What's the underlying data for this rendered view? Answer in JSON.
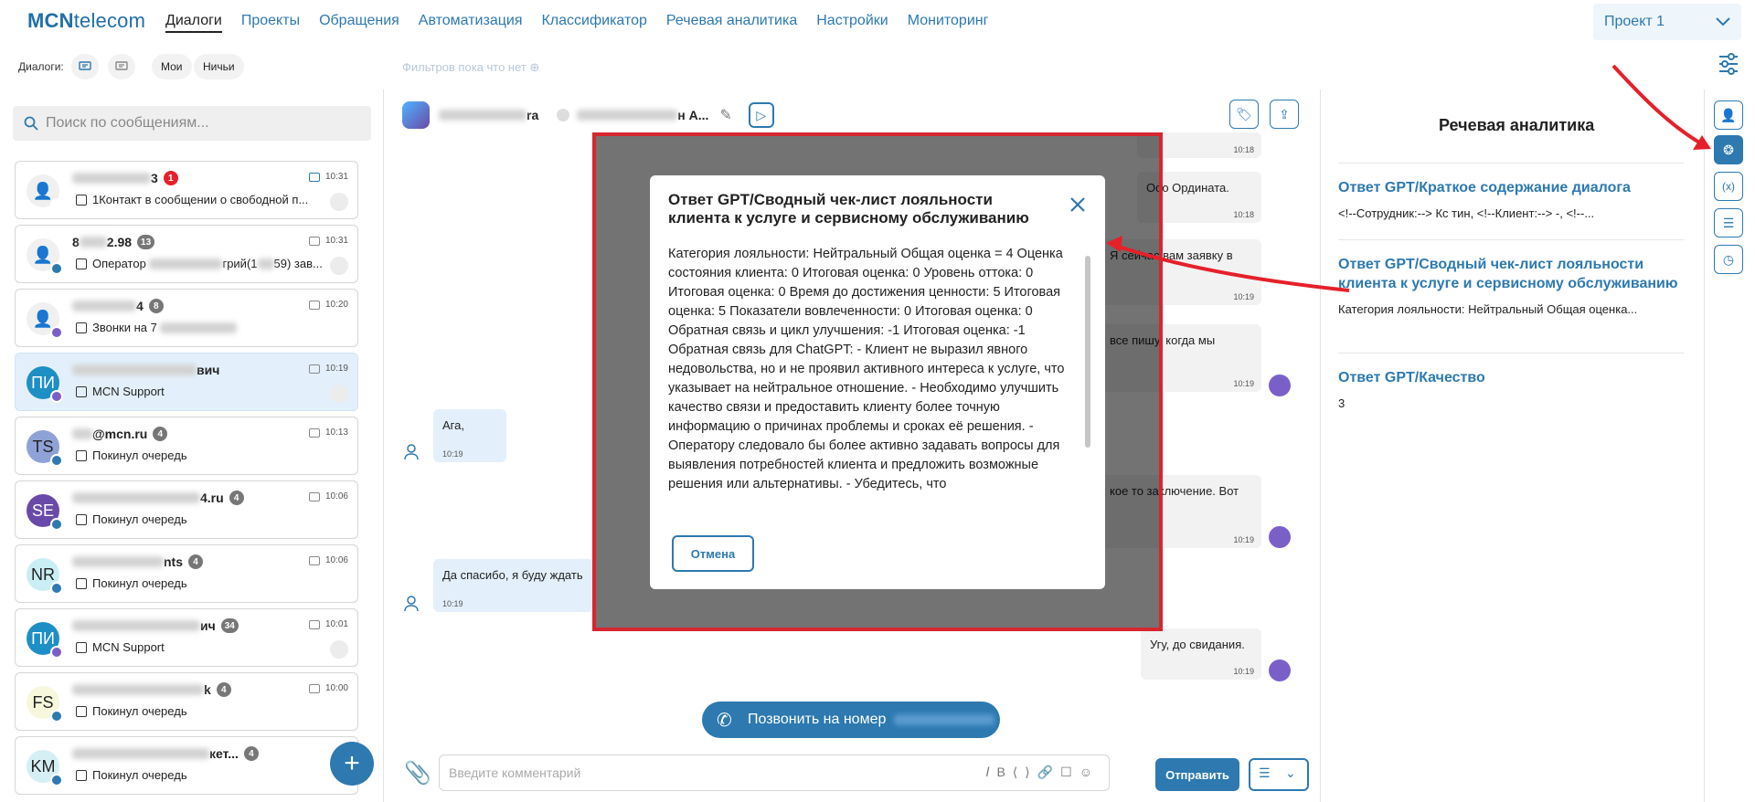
{
  "logo": {
    "bold": "MCN",
    "rest": "telecom"
  },
  "nav": [
    "Диалоги",
    "Проекты",
    "Обращения",
    "Автоматизация",
    "Классификатор",
    "Речевая аналитика",
    "Настройки",
    "Мониторинг"
  ],
  "project": "Проект 1",
  "subbar": {
    "label": "Диалоги:",
    "chip_mine": "Мои",
    "chip_none": "Ничьи",
    "filters": "Фильтров пока что нет"
  },
  "search": {
    "placeholder": "Поиск по сообщениям..."
  },
  "dialogs": [
    {
      "initials": "",
      "name_tail": "3",
      "count": "1",
      "count_red": true,
      "time": "10:31",
      "message": "1Контакт в сообщении о свободной п..."
    },
    {
      "initials": "",
      "name_tail": "8",
      "name_suffix": "2.98",
      "count": "13",
      "time": "10:31",
      "message": "Оператор",
      "message_tail": "грий(1",
      "message_tail2": "59) зав..."
    },
    {
      "initials": "",
      "name_tail": "4",
      "count": "8",
      "time": "10:20",
      "message": "Звонки на 7"
    },
    {
      "initials": "ПИ",
      "name_tail": "вич",
      "count": "",
      "time": "10:19",
      "message": "MCN Support"
    },
    {
      "initials": "TS",
      "name_tail": "@mcn.ru",
      "count": "4",
      "time": "10:13",
      "message": "Покинул очередь"
    },
    {
      "initials": "SE",
      "name_tail": "4.ru",
      "count": "4",
      "time": "10:06",
      "message": "Покинул очередь"
    },
    {
      "initials": "NR",
      "name_tail": "nts",
      "count": "4",
      "time": "10:06",
      "message": "Покинул очередь"
    },
    {
      "initials": "ПИ",
      "name_tail": "ич",
      "count": "34",
      "time": "10:01",
      "message": "MCN Support"
    },
    {
      "initials": "FS",
      "name_tail": "k",
      "count": "4",
      "time": "10:00",
      "message": "Покинул очередь"
    },
    {
      "initials": "KM",
      "name_tail": "кет...",
      "count": "4",
      "time": "",
      "message": "Покинул очередь"
    }
  ],
  "chat": {
    "head_a": "ra",
    "head_b": "н А...",
    "messages": [
      {
        "text": "",
        "time": "10:18"
      },
      {
        "text": "Ооо Ордината.",
        "time": "10:18"
      },
      {
        "text": "Я сейчас вам заявку в",
        "time": "10:19"
      },
      {
        "text": "все пишу, когда мы",
        "time": "10:19"
      },
      {
        "text": "Ага,",
        "time": "10:19"
      },
      {
        "text": "кое то заключение. Вот",
        "time": "10:19"
      },
      {
        "text": "Да спасибо, я буду ждать",
        "time": "10:19"
      },
      {
        "text": "Угу, до свидания.",
        "time": "10:19"
      }
    ],
    "call_button": "Позвонить на номер",
    "composer_placeholder": "Введите комментарий",
    "send": "Отправить"
  },
  "right_panel": {
    "title": "Речевая аналитика",
    "items": [
      {
        "title": "Ответ GPT/Краткое содержание диалога",
        "value": "<!--Сотрудник:--> Кс        тин, <!--Клиент:--> -, <!--..."
      },
      {
        "title": "Ответ GPT/Сводный чек-лист лояльности клиента к услуге и сервисному обслуживанию",
        "value": "Категория лояльности: Нейтральный Общая оценка..."
      },
      {
        "title": "Ответ GPT/Качество",
        "value": "3"
      }
    ]
  },
  "modal": {
    "title": "Ответ GPT/Сводный чек-лист лояльности клиента к услуге и сервисному обслуживанию",
    "body": "Категория лояльности: Нейтральный Общая оценка = 4 Оценка состояния клиента: 0 Итоговая оценка: 0 Уровень оттока: 0 Итоговая оценка: 0 Время до достижения ценности: 5 Итоговая оценка: 5 Показатели вовлеченности: 0 Итоговая оценка: 0 Обратная связь и цикл улучшения: -1 Итоговая оценка: -1 Обратная связь для ChatGPT: - Клиент не выразил явного недовольства, но и не проявил активного интереса к услуге, что указывает на нейтральное отношение. - Необходимо улучшить качество связи и предоставить клиенту более точную информацию о причинах проблемы и сроках её решения. - Оператору следовало бы более активно задавать вопросы для выявления потребностей клиента и предложить возможные решения или альтернативы. - Убедитесь, что",
    "cancel": "Отмена"
  },
  "colors": {
    "accent": "#2d79b0",
    "highlight": "#d6262e",
    "operator": "#7b5fc9"
  }
}
